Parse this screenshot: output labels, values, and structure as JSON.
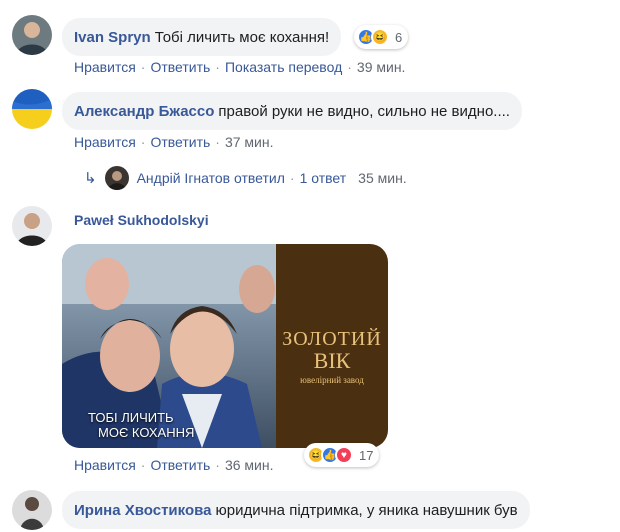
{
  "comments": [
    {
      "author": "Ivan Spryn",
      "text": "Тобі личить моє кохання!",
      "reaction_count": "6",
      "actions": [
        "Нравится",
        "Ответить",
        "Показать перевод"
      ],
      "time": "39 мин."
    },
    {
      "author": "Александр Бжассо",
      "text": "правой руки не видно, сильно не видно....",
      "actions": [
        "Нравится",
        "Ответить"
      ],
      "time": "37 мин.",
      "reply_summary": {
        "replier": "Андрій Ігнатов ответил",
        "count_label": "1 ответ",
        "time": "35 мин."
      }
    },
    {
      "author": "Paweł Sukhodolskyi",
      "image": {
        "caption_line1": "ТОБІ ЛИЧИТЬ",
        "caption_line2": "МОЄ КОХАННЯ",
        "brand_line1": "ЗОЛОТИЙ",
        "brand_line2": "ВІК",
        "brand_sub": "ювелірний завод"
      },
      "reaction_count": "17",
      "actions": [
        "Нравится",
        "Ответить"
      ],
      "time": "36 мин."
    },
    {
      "author": "Ирина Хвостикова",
      "text": "юридична підтримка, у яника навушник був"
    }
  ],
  "colors": {
    "link": "#385898",
    "bubble": "#f2f3f5",
    "meta": "#606770",
    "like": "#3578e5",
    "haha": "#f7b928",
    "love": "#f33e58",
    "brand_bg": "#4a2f10",
    "brand_gold": "#e8c27a"
  }
}
